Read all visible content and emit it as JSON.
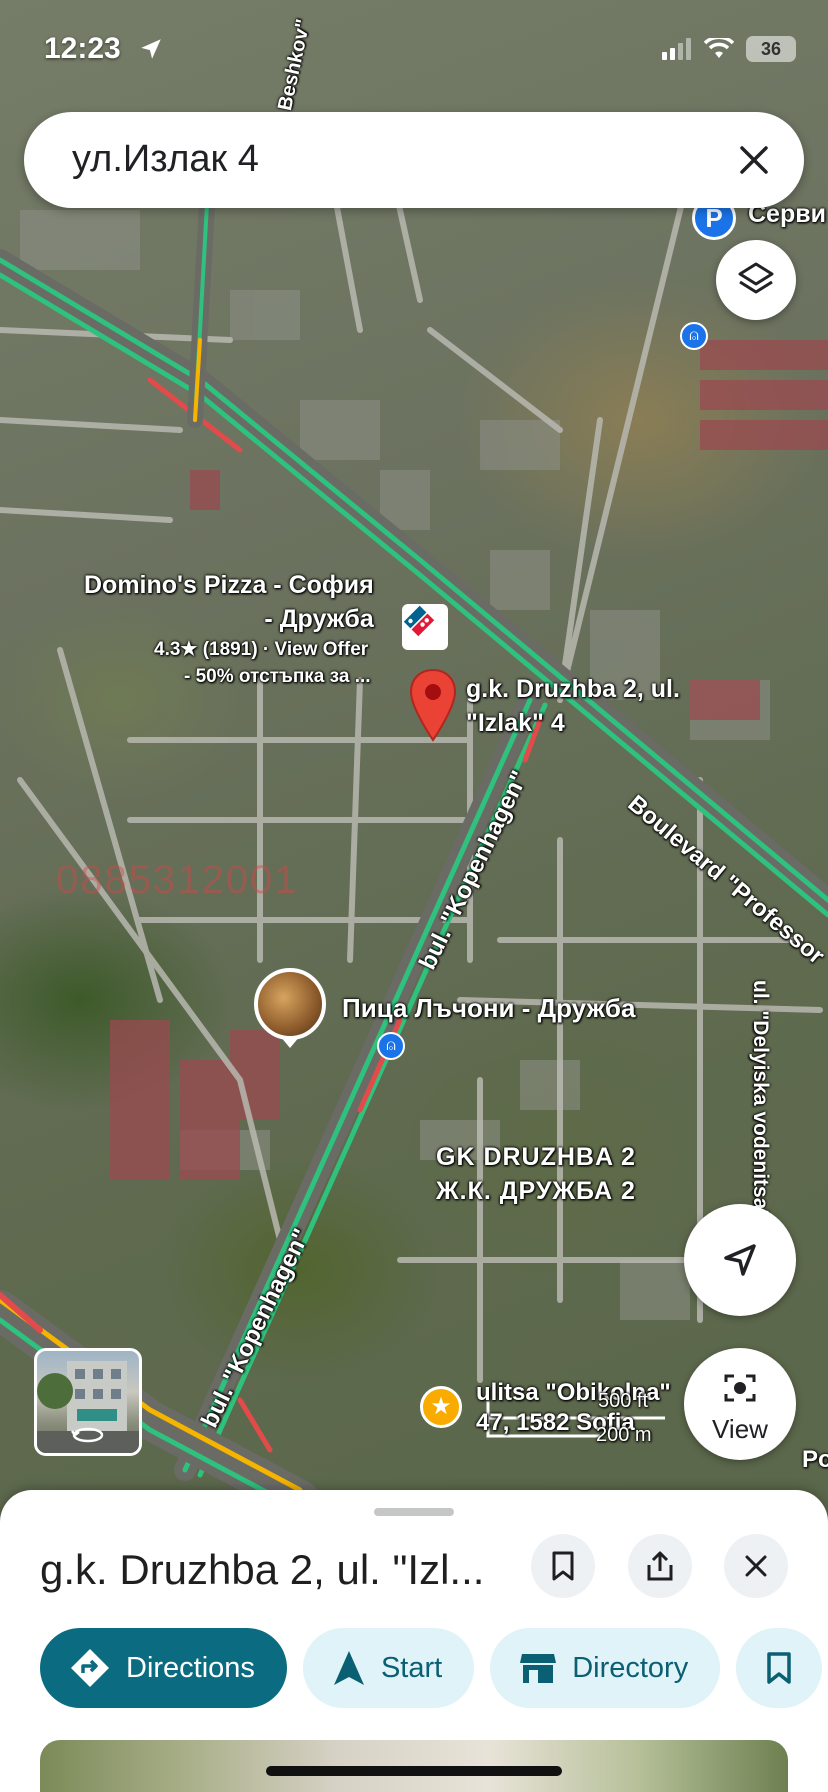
{
  "status_bar": {
    "time": "12:23",
    "battery": "36"
  },
  "search": {
    "query": "ул.Излак 4"
  },
  "map": {
    "labels": {
      "dominos_name": "Domino's Pizza - София - Дружба",
      "dominos_name_line1": "Domino's Pizza - София",
      "dominos_name_line2": "- Дружба",
      "dominos_rating": "4.3★ (1891) · View Offer",
      "dominos_offer": "- 50% отстъпка за ...",
      "pin_line1": "g.k. Druzhba 2, ul.",
      "pin_line2": "\"Izlak\" 4",
      "pizza_lachoni": "Пица Лъчони - Дружба",
      "district_en": "GK DRUZHBA 2",
      "district_bg": "Ж.К. ДРУЖБА 2",
      "street_kopenhagen_top": "bul. \"Kopenhagen\"",
      "street_kopenhagen_bottom": "bul. \"Kopenhagen\"",
      "boulevard_professor": "Boulevard \"Professor",
      "street_delyiska": "ul. \"Delyiska vodenitsa\"",
      "street_obikolna_line1": "ulitsa \"Obikolna\"",
      "street_obikolna_line2": "47, 1582 Sofia",
      "service_partial": "Серви",
      "beshkov_partial": "Beshkov\"",
      "watermark_phone": "0885312001",
      "scale_ft": "500 ft",
      "scale_m": "200 m",
      "right_edge": "Po"
    }
  },
  "buttons": {
    "view_label": "View"
  },
  "sheet": {
    "title": "g.k. Druzhba 2, ul. \"Izl...",
    "chips": [
      {
        "label": "Directions",
        "icon": "directions-icon"
      },
      {
        "label": "Start",
        "icon": "navigation-arrow-icon"
      },
      {
        "label": "Directory",
        "icon": "store-icon"
      }
    ]
  },
  "colors": {
    "accent": "#0b6b80",
    "chip_bg": "#dff3f8",
    "pin": "#ea4335",
    "traffic_green": "#2ec27e"
  }
}
